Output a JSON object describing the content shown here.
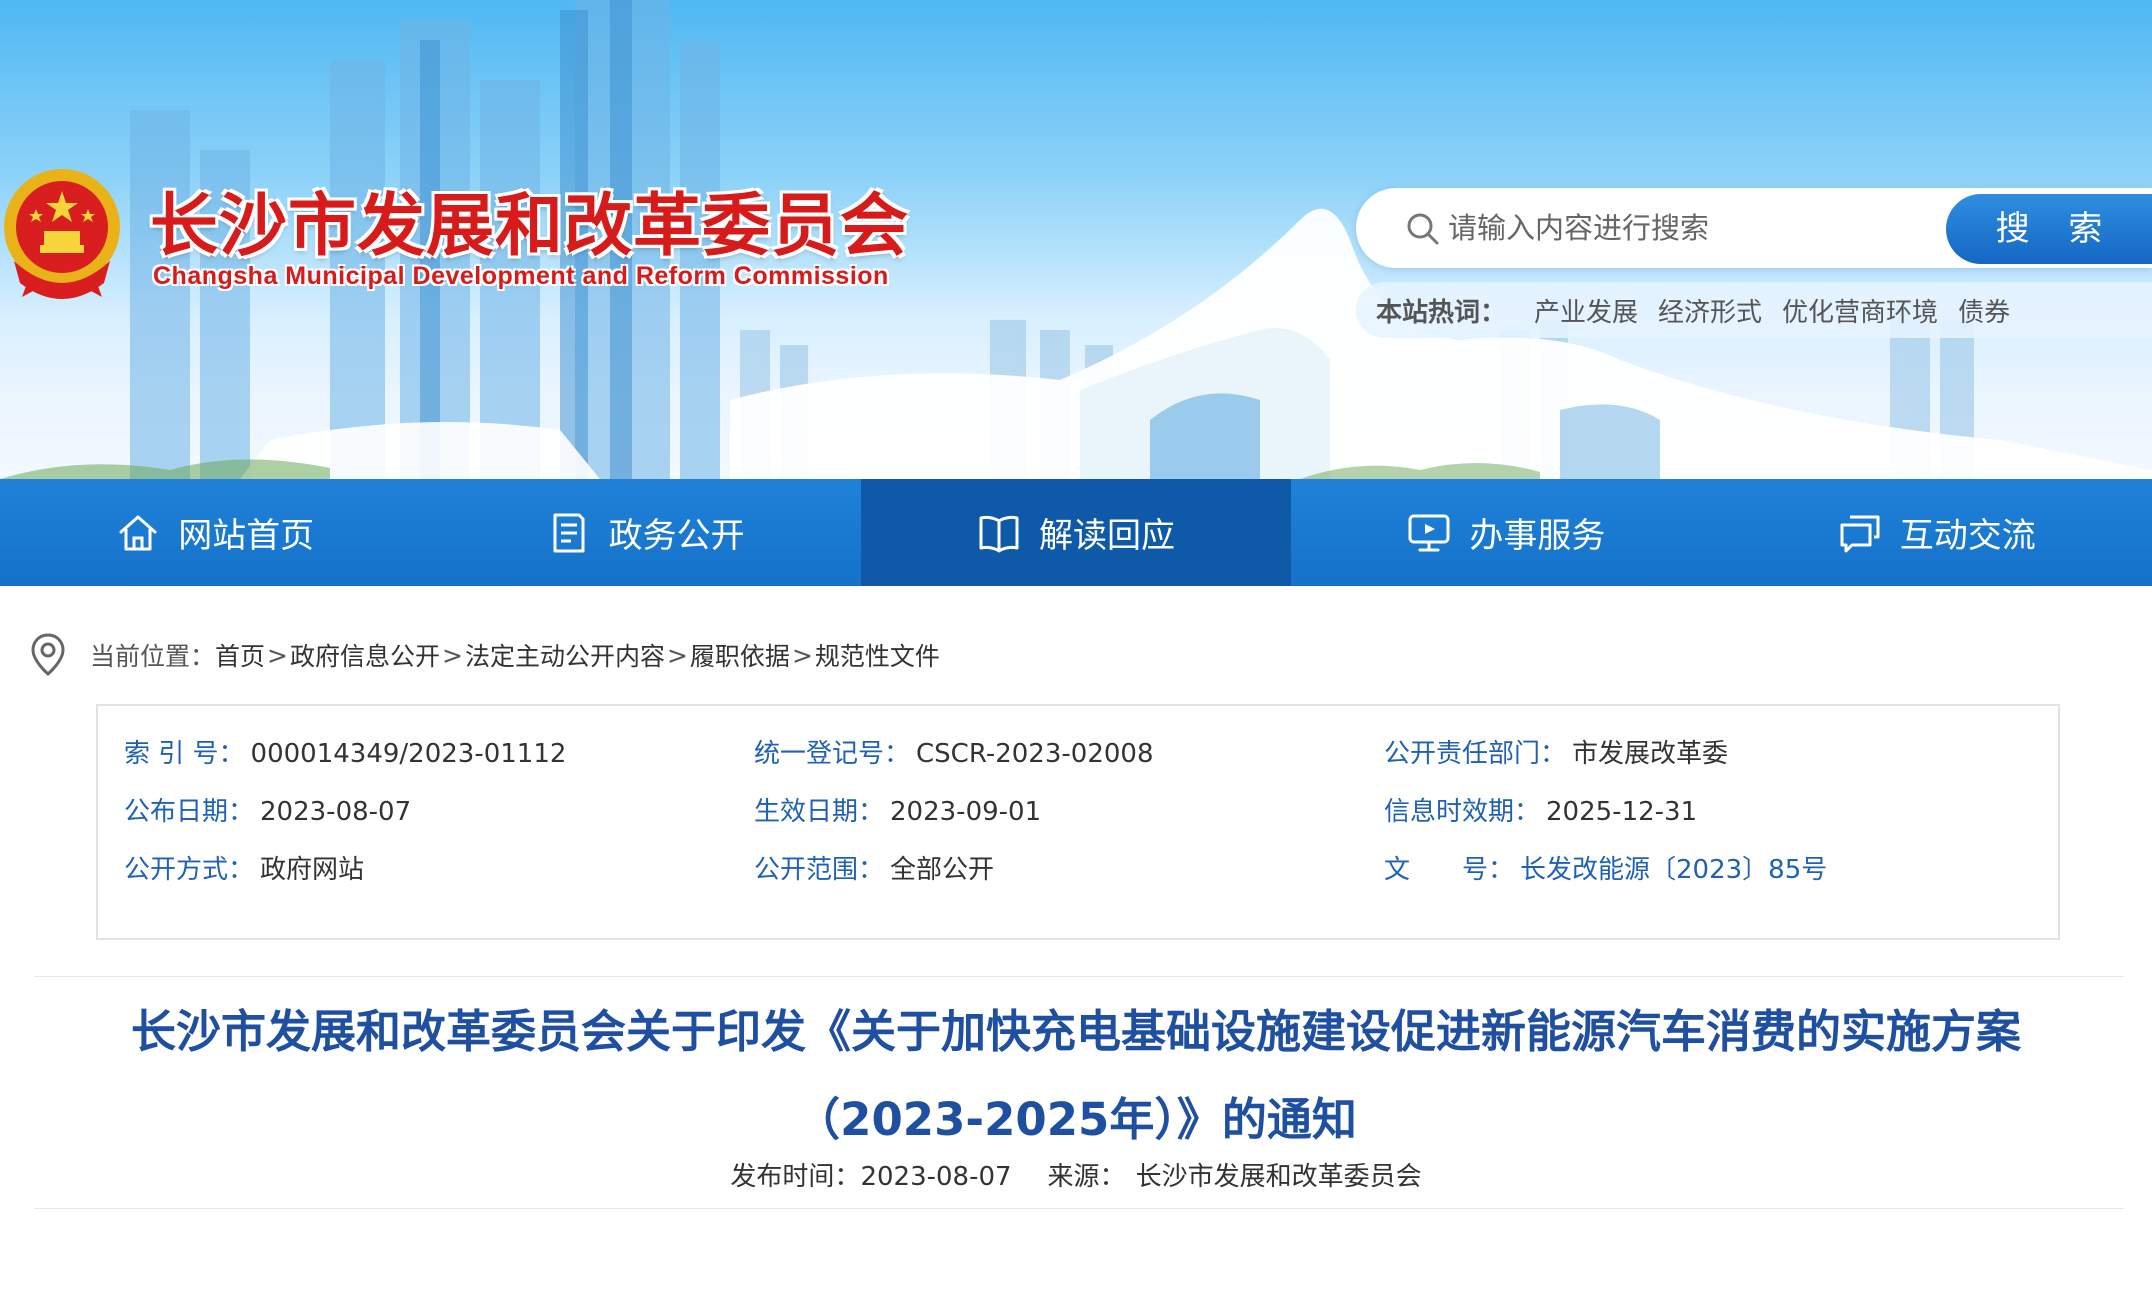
{
  "banner": {
    "title": "长沙市发展和改革委员会",
    "subtitle": "Changsha Municipal Development and Reform Commission"
  },
  "search": {
    "placeholder": "请输入内容进行搜索",
    "button_label": "搜 索",
    "hotwords_label": "本站热词：",
    "hotwords": [
      "产业发展",
      "经济形式",
      "优化营商环境",
      "债券"
    ]
  },
  "nav": {
    "items": [
      {
        "label": "网站首页",
        "icon": "home-icon"
      },
      {
        "label": "政务公开",
        "icon": "document-icon"
      },
      {
        "label": "解读回应",
        "icon": "book-icon",
        "active": true
      },
      {
        "label": "办事服务",
        "icon": "monitor-icon"
      },
      {
        "label": "互动交流",
        "icon": "chat-icon"
      }
    ]
  },
  "breadcrumb": {
    "label": "当前位置：",
    "items": [
      "首页",
      "政府信息公开",
      "法定主动公开内容",
      "履职依据",
      "规范性文件"
    ],
    "separator": ">"
  },
  "meta": {
    "index_key": "索 引 号：",
    "index_val": "000014349/2023-01112",
    "reg_key": "统一登记号：",
    "reg_val": "CSCR-2023-02008",
    "dept_key": "公开责任部门：",
    "dept_val": "市发展改革委",
    "pubdate_key": "公布日期：",
    "pubdate_val": "2023-08-07",
    "effdate_key": "生效日期：",
    "effdate_val": "2023-09-01",
    "validity_key": "信息时效期：",
    "validity_val": "2025-12-31",
    "mode_key": "公开方式：",
    "mode_val": "政府网站",
    "scope_key": "公开范围：",
    "scope_val": "全部公开",
    "docno_key": "文　　号：",
    "docno_val": "长发改能源〔2023〕85号"
  },
  "article": {
    "title": "长沙市发展和改革委员会关于印发《关于加快充电基础设施建设促进新能源汽车消费的实施方案（2023-2025年）》的通知",
    "publish_label": "发布时间：",
    "publish_date": "2023-08-07",
    "source_label": "来源：",
    "source": "长沙市发展和改革委员会"
  },
  "colors": {
    "nav_bg": "#1571c9",
    "nav_active": "#0e5aa8",
    "title_red": "#d71a1a",
    "link_blue": "#1f61b7",
    "article_title": "#1f4fa0"
  }
}
